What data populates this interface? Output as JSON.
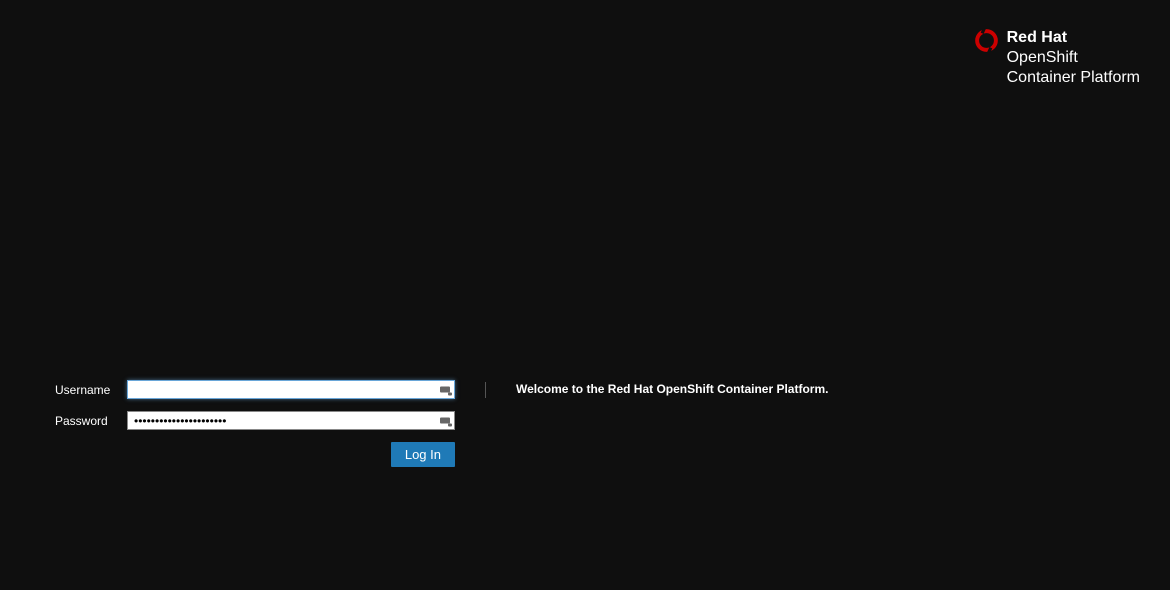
{
  "branding": {
    "line1": "Red Hat",
    "line2": "OpenShift",
    "line3": "Container Platform",
    "icon_name": "redhat-openshift-icon",
    "accent_color": "#cc0000"
  },
  "form": {
    "username_label": "Username",
    "password_label": "Password",
    "username_value": "",
    "password_value": "••••••••••••••••••••••",
    "login_button_label": "Log In"
  },
  "welcome": {
    "message": "Welcome to the Red Hat OpenShift Container Platform."
  }
}
